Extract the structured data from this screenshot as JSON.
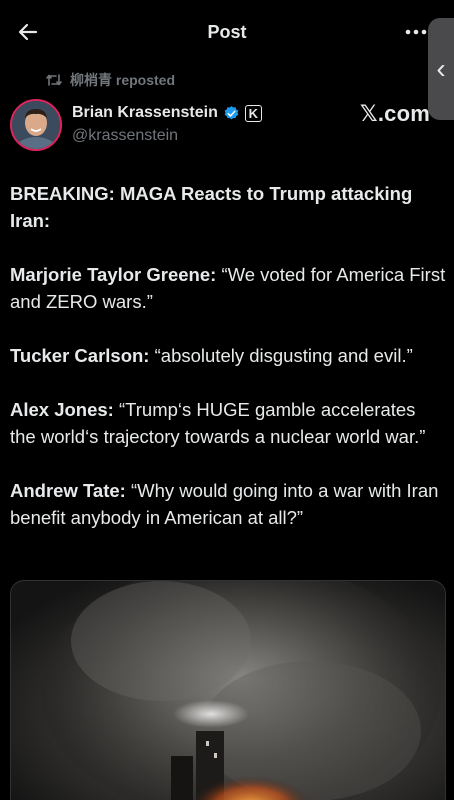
{
  "topbar": {
    "title": "Post",
    "back_icon": "arrow-left-icon",
    "more_icon": "more-horizontal-icon"
  },
  "side_handle": {
    "glyph": "‹"
  },
  "repost": {
    "icon": "repost-icon",
    "text": "柳梢青 reposted"
  },
  "author": {
    "name": "Brian Krassenstein",
    "handle": "@krassenstein",
    "verified_badge": "verified-badge-icon",
    "affiliate_badge": "K"
  },
  "watermark": "𝕏.com",
  "post": {
    "headline": "BREAKING:  MAGA Reacts to Trump attacking Iran:",
    "quotes": [
      {
        "speaker": "Marjorie Taylor Greene:",
        "text": " “We voted for America First and ZERO wars.”"
      },
      {
        "speaker": "Tucker Carlson:",
        "text": " “absolutely disgusting and evil.”"
      },
      {
        "speaker": "Alex Jones:",
        "text": " “Trump‘s HUGE gamble accelerates the world‘s trajectory towards a nuclear world war.”"
      },
      {
        "speaker": "Andrew Tate:",
        "text": " “Why would going into a war with Iran benefit anybody in American at all?”"
      }
    ]
  },
  "colors": {
    "background": "#000000",
    "text_primary": "#e7e9ea",
    "text_secondary": "#71767b",
    "verified_blue": "#1d9bf0",
    "avatar_ring": "#e0245e"
  }
}
